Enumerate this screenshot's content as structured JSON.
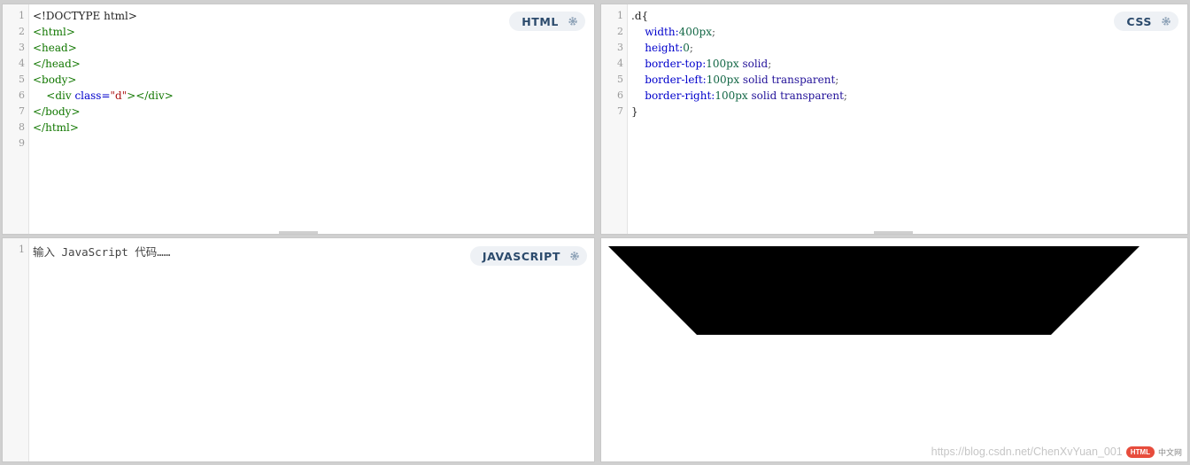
{
  "panels": {
    "html": {
      "label": "HTML",
      "line_numbers": [
        "1",
        "2",
        "3",
        "4",
        "5",
        "6",
        "7",
        "8",
        "9"
      ],
      "lines": [
        {
          "text": "<!DOCTYPE html>"
        },
        {
          "text": "<html>"
        },
        {
          "text": "<head>"
        },
        {
          "text": "</head>"
        },
        {
          "text": "<body>"
        },
        {
          "indent": "    ",
          "tag_open": "<div ",
          "attr": "class=",
          "str": "\"d\"",
          "tag_close": "></div>"
        },
        {
          "text": "</body>"
        },
        {
          "text": "</html>"
        },
        {
          "text": ""
        }
      ]
    },
    "css": {
      "label": "CSS",
      "line_numbers": [
        "1",
        "2",
        "3",
        "4",
        "5",
        "6",
        "7"
      ],
      "lines": {
        "l1": ".d{",
        "l2_prop": "width:",
        "l2_val": "400px",
        "l2_end": ";",
        "l3_prop": "height:",
        "l3_val": "0",
        "l3_end": ";",
        "l4_prop": "border-top:",
        "l4_num": "100px",
        "l4_kw": " solid",
        "l4_end": ";",
        "l5_prop": "border-left:",
        "l5_num": "100px",
        "l5_kw": " solid transparent",
        "l5_end": ";",
        "l6_prop": "border-right:",
        "l6_num": "100px",
        "l6_kw": " solid transparent",
        "l6_end": ";",
        "l7": "}"
      }
    },
    "javascript": {
      "label": "JAVASCRIPT",
      "line_numbers": [
        "1"
      ],
      "placeholder": "输入 JavaScript 代码……"
    },
    "result": {
      "shape_color": "#000000"
    }
  },
  "watermark": {
    "logo": "HTML",
    "cn": "中文网",
    "url": "https://blog.csdn.net/ChenXvYuan_001"
  }
}
